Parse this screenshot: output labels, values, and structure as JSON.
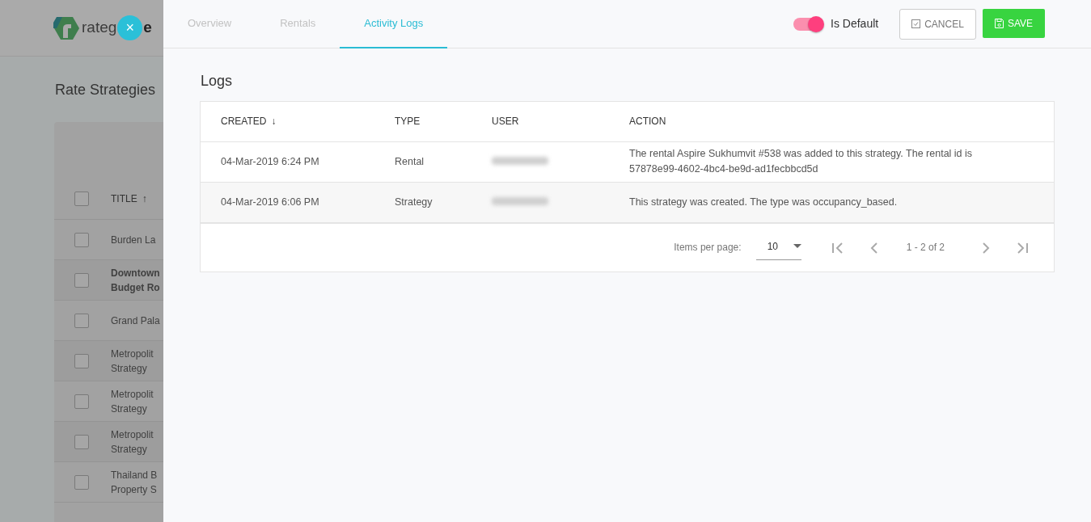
{
  "background": {
    "logo": {
      "text_before": "rateg",
      "text_after": "e"
    },
    "page_title": "Rate Strategies",
    "table": {
      "title_column": "TITLE",
      "sort_arrow": "↑",
      "select_all_checked": false,
      "rows": [
        {
          "lines": [
            "Burden La"
          ],
          "bold": false,
          "checked": false
        },
        {
          "lines": [
            "Downtown",
            "Budget Ro"
          ],
          "bold": true,
          "checked": false
        },
        {
          "lines": [
            "Grand Pala"
          ],
          "bold": false,
          "checked": false
        },
        {
          "lines": [
            "Metropolit",
            "Strategy"
          ],
          "bold": false,
          "checked": false
        },
        {
          "lines": [
            "Metropolit",
            "Strategy"
          ],
          "bold": false,
          "checked": false
        },
        {
          "lines": [
            "Metropolit",
            "Strategy"
          ],
          "bold": false,
          "checked": false
        },
        {
          "lines": [
            "Thailand B",
            "Property S"
          ],
          "bold": false,
          "checked": false
        }
      ]
    }
  },
  "close_button": {
    "label": "×"
  },
  "tabs": [
    {
      "label": "Overview",
      "selected": false
    },
    {
      "label": "Rentals",
      "selected": false
    },
    {
      "label": "Activity Logs",
      "selected": true
    }
  ],
  "is_default": {
    "label": "Is Default",
    "on": true
  },
  "buttons": [
    {
      "kind": "cancel",
      "label": "CANCEL"
    },
    {
      "kind": "save",
      "label": "SAVE"
    }
  ],
  "logs": {
    "title": "Logs",
    "columns": [
      {
        "label": "CREATED",
        "sort_arrow": "↓"
      },
      {
        "label": "TYPE"
      },
      {
        "label": "USER"
      },
      {
        "label": "ACTION"
      }
    ],
    "rows": [
      {
        "created": "04-Mar-2019 6:24 PM",
        "type": "Rental",
        "user_redacted": true,
        "action": "The rental Aspire Sukhumvit #538 was added to this strategy. The rental id is 57878e99-4602-4bc4-be9d-ad1fecbbcd5d"
      },
      {
        "created": "04-Mar-2019 6:06 PM",
        "type": "Strategy",
        "user_redacted": true,
        "action": "This strategy was created. The type was occupancy_based."
      }
    ],
    "paginator": {
      "items_per_page_label": "Items per page:",
      "page_size": "10",
      "range": "1 - 2 of 2"
    }
  }
}
